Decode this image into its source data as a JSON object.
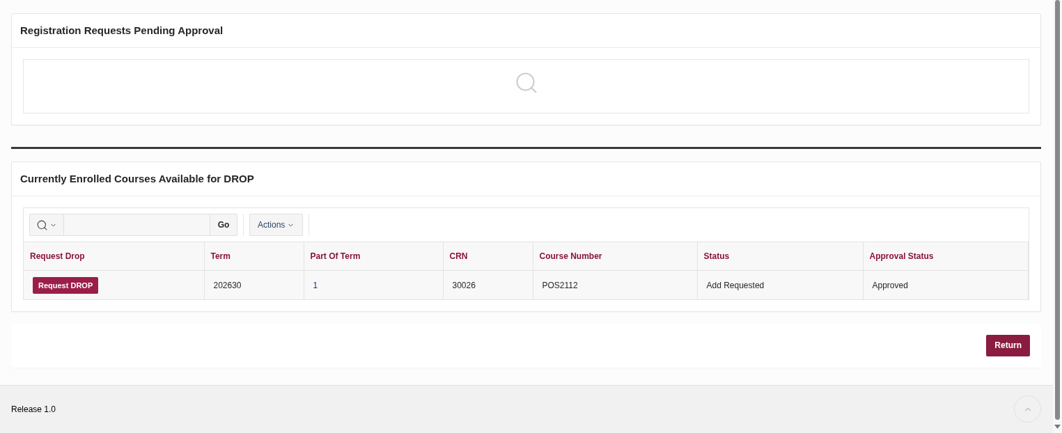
{
  "regions": [
    {
      "kind": "empty_report",
      "title": "Registration Requests Pending Approval"
    },
    {
      "kind": "report",
      "title": "Currently Enrolled Courses Available for DROP",
      "toolbar": {
        "go_button": "Go",
        "actions_button": "Actions"
      },
      "table": {
        "columns": [
          "Request Drop",
          "Term",
          "Part Of Term",
          "CRN",
          "Course Number",
          "Status",
          "Approval Status"
        ],
        "rows": [
          {
            "cells": [
              {
                "kind": "button",
                "text": "Request DROP"
              },
              {
                "kind": "text",
                "text": "202630"
              },
              {
                "kind": "link",
                "text": "1"
              },
              {
                "kind": "text",
                "text": "30026"
              },
              {
                "kind": "text",
                "text": "POS2112"
              },
              {
                "kind": "text",
                "text": "Add Requested"
              },
              {
                "kind": "text",
                "text": "Approved"
              }
            ]
          }
        ]
      }
    }
  ],
  "buttons": [
    {
      "label": "Return"
    }
  ],
  "footer": {
    "text": "Release 1.0"
  }
}
